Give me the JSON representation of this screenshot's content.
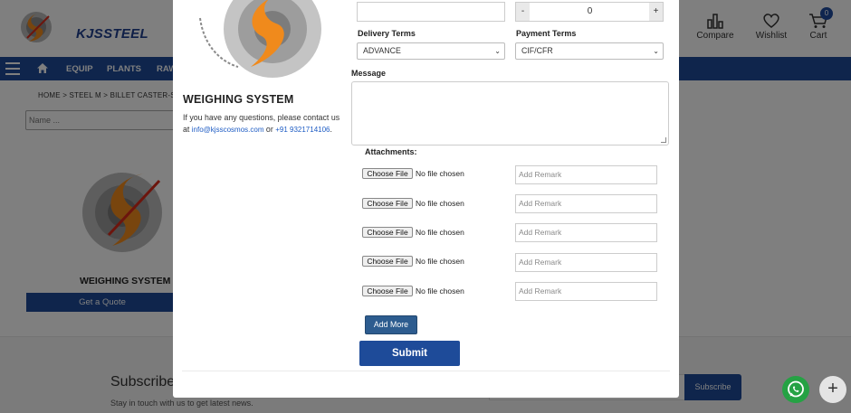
{
  "header": {
    "brand": "KJSSTEEL",
    "compare_label": "Compare",
    "wishlist_label": "Wishlist",
    "cart_label": "Cart",
    "cart_count": "0"
  },
  "nav": {
    "items": [
      "EQUIP",
      "PLANTS",
      "RAW"
    ]
  },
  "breadcrumb": "HOME > STEEL M > BILLET CASTER-SM >",
  "search": {
    "placeholder": "Name ..."
  },
  "product": {
    "title": "WEIGHING SYSTEM",
    "quote_label": "Get a Quote"
  },
  "footer": {
    "subscribe_title": "Subscribe",
    "subscribe_sub": "Stay in touch with us to get latest news.",
    "subscribe_button": "Subscribe",
    "plus_label": "+"
  },
  "modal": {
    "title": "WEIGHING SYSTEM",
    "desc_prefix": "If you have any questions, please contact us at ",
    "email": "info@kjsscosmos.com",
    "desc_or": " or ",
    "phone": "+91 9321714106",
    "desc_suffix": ".",
    "quantity": {
      "minus": "-",
      "value": "0",
      "plus": "+"
    },
    "delivery_terms": {
      "label": "Delivery Terms",
      "selected": "ADVANCE"
    },
    "payment_terms": {
      "label": "Payment Terms",
      "selected": "CIF/CFR"
    },
    "message_label": "Message",
    "attachments_label": "Attachments:",
    "attachments": [
      {
        "button": "Choose File",
        "status": "No file chosen",
        "remark_placeholder": "Add Remark"
      },
      {
        "button": "Choose File",
        "status": "No file chosen",
        "remark_placeholder": "Add Remark"
      },
      {
        "button": "Choose File",
        "status": "No file chosen",
        "remark_placeholder": "Add Remark"
      },
      {
        "button": "Choose File",
        "status": "No file chosen",
        "remark_placeholder": "Add Remark"
      },
      {
        "button": "Choose File",
        "status": "No file chosen",
        "remark_placeholder": "Add Remark"
      }
    ],
    "add_more_label": "Add More",
    "submit_label": "Submit"
  },
  "colors": {
    "primary": "#1e4b99",
    "logo_orange": "#f08a1c",
    "whatsapp": "#25a244"
  }
}
